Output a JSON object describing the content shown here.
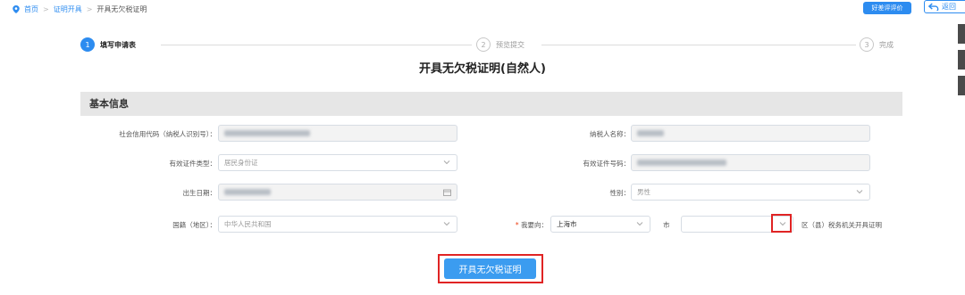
{
  "breadcrumb": {
    "home": "首页",
    "parent": "证明开具",
    "current": "开具无欠税证明",
    "sep": ">"
  },
  "top_buttons": {
    "rate": "好差评评价",
    "back": "返回"
  },
  "steps": [
    {
      "num": "1",
      "label": "填写申请表"
    },
    {
      "num": "2",
      "label": "预览提交"
    },
    {
      "num": "3",
      "label": "完成"
    }
  ],
  "page_title": "开具无欠税证明(自然人)",
  "section_title": "基本信息",
  "fields": {
    "credit_code_label": "社会信用代码（纳税人识别号）：",
    "taxpayer_name_label": "纳税人名称：",
    "id_type_label": "有效证件类型：",
    "id_type_value": "居民身份证",
    "id_number_label": "有效证件号码：",
    "birth_label": "出生日期：",
    "gender_label": "性别：",
    "gender_value": "男性",
    "nationality_label": "国籍（地区）：",
    "nationality_value": "中华人民共和国",
    "apply_to_label": "我要向：",
    "apply_to_required": "*",
    "province_value": "上海市",
    "city_label": "市",
    "district_suffix": "区（县）税务机关开具证明"
  },
  "submit_label": "开具无欠税证明",
  "colors": {
    "primary": "#2d8cf0",
    "highlight": "#e02424",
    "section_bg": "#e6e6e6"
  }
}
